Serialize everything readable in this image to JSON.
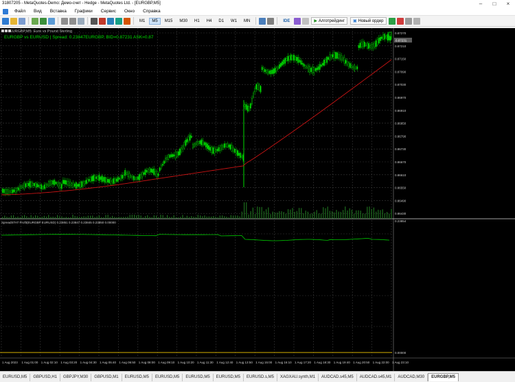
{
  "window": {
    "title": "31807205 - MetaQuotes-Demo: Демо-счет - Hedge - MetaQuotes Ltd. - [EURGBP,M5]"
  },
  "menu": [
    {
      "id": "file",
      "label": "Файл"
    },
    {
      "id": "view",
      "label": "Вид"
    },
    {
      "id": "insert",
      "label": "Вставка"
    },
    {
      "id": "charts",
      "label": "Графики"
    },
    {
      "id": "service",
      "label": "Сервис"
    },
    {
      "id": "window",
      "label": "Окно"
    },
    {
      "id": "help",
      "label": "Справка"
    }
  ],
  "toolbar": {
    "timeframes": [
      {
        "label": "M1",
        "active": false
      },
      {
        "label": "M5",
        "active": true
      },
      {
        "label": "M15",
        "active": false
      },
      {
        "label": "M30",
        "active": false
      },
      {
        "label": "H1",
        "active": false
      },
      {
        "label": "H4",
        "active": false
      },
      {
        "label": "D1",
        "active": false
      },
      {
        "label": "W1",
        "active": false
      },
      {
        "label": "MN",
        "active": false
      }
    ],
    "ide_label": "IDE",
    "algo_label": "Алготрейдинг",
    "new_order_label": "Новый ордер"
  },
  "chart": {
    "title": "EURGBP,M5: Euro vs Pound Sterling",
    "status": "EURGBP vs EURUSD | Spread: 0.23847EURGBP, BID=0.87231 ASK=0.87",
    "current_price_label": "0.87231",
    "indicator_label": "SpreadSTAT Profit(EURGBP EURUSD) 0.23851 0.23847 0.23845 0.23850 0.00000",
    "indicator_zero_label": "0.23854",
    "bottom_level_label": "0.00000",
    "price_axis": [
      "0.87270",
      "0.87210",
      "0.87150",
      "0.87090",
      "0.87030",
      "0.86970",
      "0.86910",
      "0.86850",
      "0.86790",
      "0.86730",
      "0.86670",
      "0.86610",
      "0.86550",
      "0.86490",
      "0.86430"
    ],
    "time_axis": [
      "1 Aug 2023",
      "1 Aug 01:00",
      "1 Aug 02:10",
      "1 Aug 03:20",
      "1 Aug 04:30",
      "1 Aug 05:40",
      "1 Aug 06:50",
      "1 Aug 08:00",
      "1 Aug 09:10",
      "1 Aug 10:20",
      "1 Aug 11:30",
      "1 Aug 12:40",
      "1 Aug 13:50",
      "1 Aug 15:00",
      "1 Aug 16:10",
      "1 Aug 17:20",
      "1 Aug 18:30",
      "1 Aug 19:40",
      "1 Aug 20:50",
      "1 Aug 22:00",
      "1 Aug 23:10"
    ],
    "colors": {
      "candle": "#00dd00",
      "ma": "#c81414",
      "indicator": "#00cc00",
      "grid": "#3a3a3a",
      "level": "#d6b000"
    }
  },
  "tabs": [
    {
      "label": "EURUSD,M5",
      "active": false
    },
    {
      "label": "GBPUSD,H1",
      "active": false
    },
    {
      "label": "GBPJPY,M30",
      "active": false
    },
    {
      "label": "GBPUSD,M1",
      "active": false
    },
    {
      "label": "EURUSD,M5",
      "active": false
    },
    {
      "label": "EURUSD,M5",
      "active": false
    },
    {
      "label": "EURUSD,M5",
      "active": false
    },
    {
      "label": "EURUSD,M5",
      "active": false
    },
    {
      "label": "EURUSD.s,M5",
      "active": false
    },
    {
      "label": "XAGXAU.synth,M1",
      "active": false
    },
    {
      "label": "AUDCAD.s45,M5",
      "active": false
    },
    {
      "label": "AUDCAD.s45,M1",
      "active": false
    },
    {
      "label": "AUDCAD,M30",
      "active": false
    },
    {
      "label": "EURGBP,M5",
      "active": true
    }
  ]
}
